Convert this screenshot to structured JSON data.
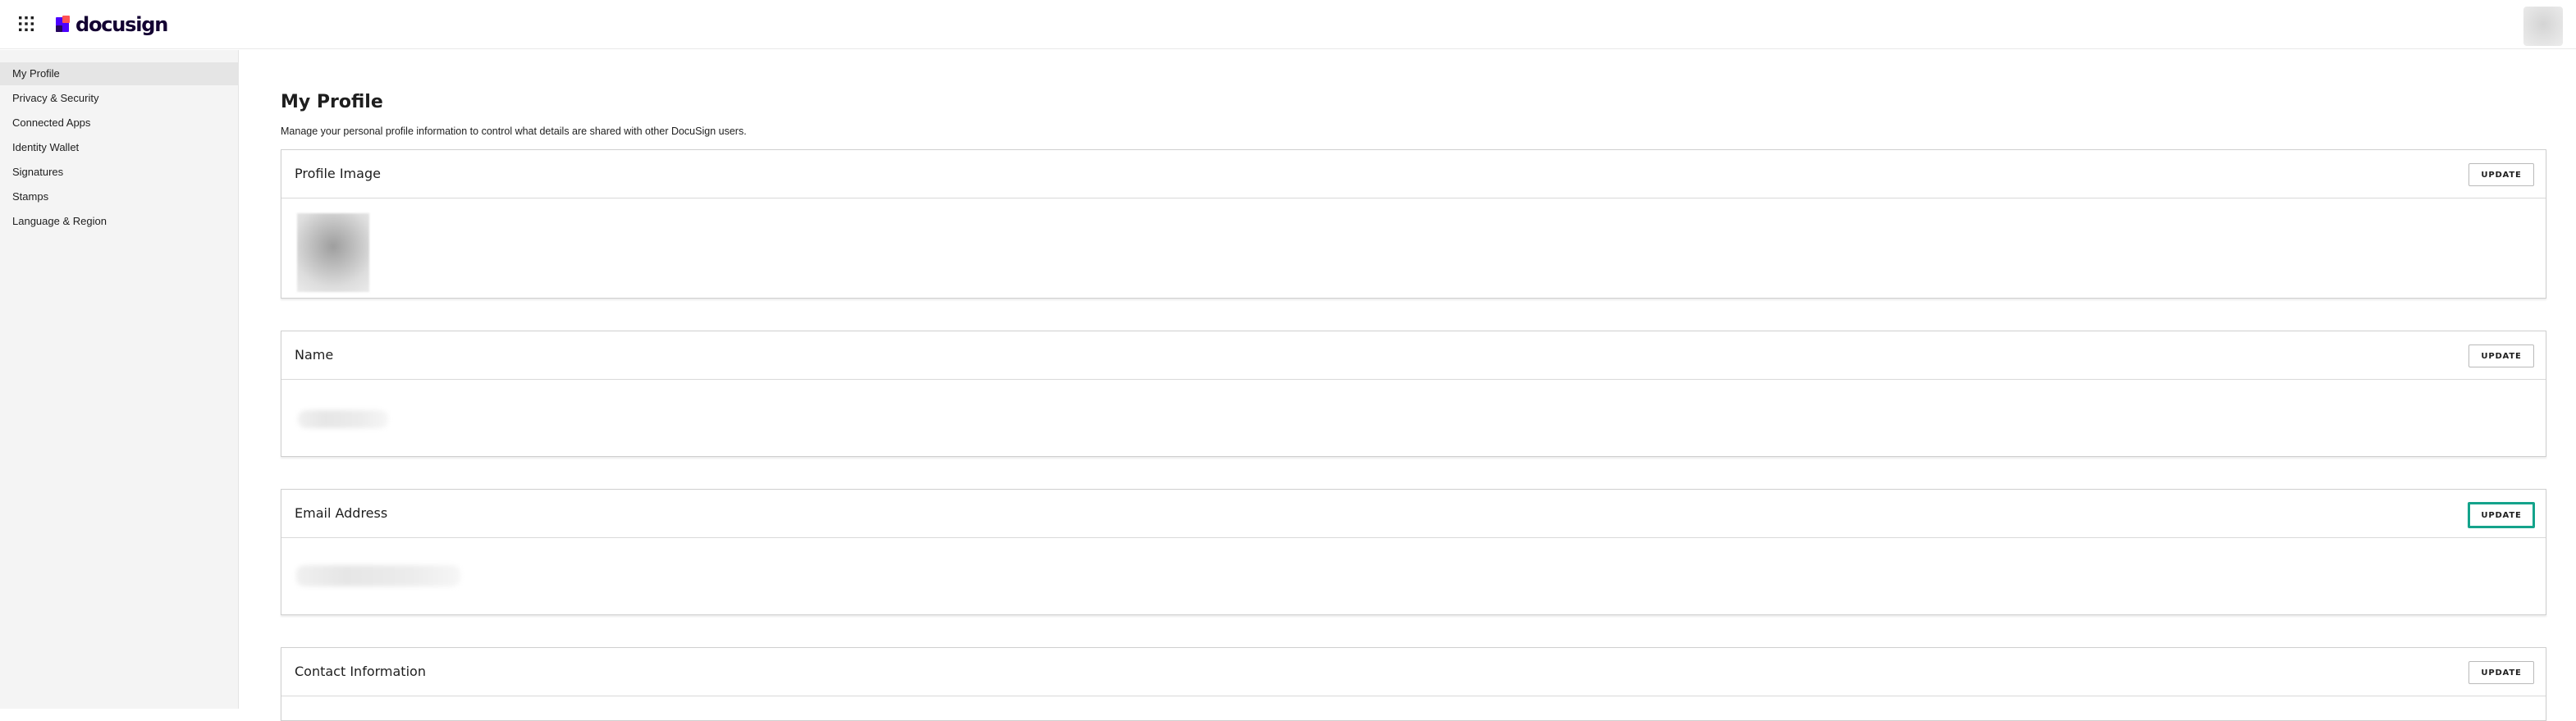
{
  "header": {
    "logo_text": "docusign",
    "apps_icon": "grid-icon",
    "brand_colors": [
      "#4c00ff",
      "#ff5252",
      "#130032"
    ]
  },
  "sidebar": {
    "items": [
      {
        "label": "My Profile",
        "active": true
      },
      {
        "label": "Privacy & Security",
        "active": false
      },
      {
        "label": "Connected Apps",
        "active": false
      },
      {
        "label": "Identity Wallet",
        "active": false
      },
      {
        "label": "Signatures",
        "active": false
      },
      {
        "label": "Stamps",
        "active": false
      },
      {
        "label": "Language & Region",
        "active": false
      }
    ]
  },
  "main": {
    "title": "My Profile",
    "description": "Manage your personal profile information to control what details are shared with other DocuSign users.",
    "sections": [
      {
        "title": "Profile Image",
        "button": "UPDATE"
      },
      {
        "title": "Name",
        "button": "UPDATE"
      },
      {
        "title": "Email Address",
        "button": "UPDATE"
      },
      {
        "title": "Contact Information",
        "button": "UPDATE"
      }
    ],
    "focus_color": "#14a38b"
  }
}
